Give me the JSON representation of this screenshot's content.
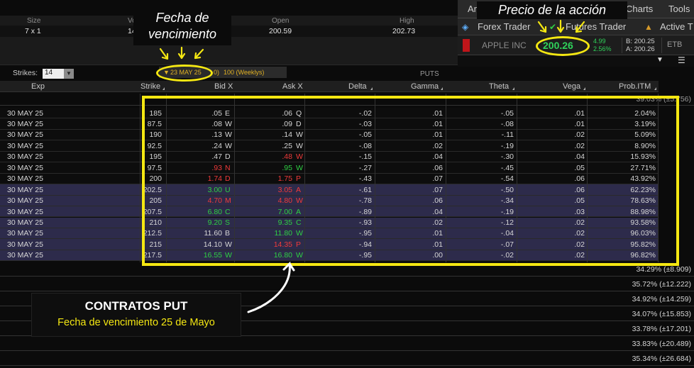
{
  "stats": {
    "headers": [
      "Size",
      "Vo",
      "Open",
      "High"
    ],
    "values": [
      "7 x 1",
      "14",
      "200.59",
      "202.73"
    ]
  },
  "tabs": {
    "row1": [
      "Ana",
      "Charts",
      "Tools"
    ],
    "row2": [
      "Forex Trader",
      "Futures Trader",
      "Active T"
    ]
  },
  "quote": {
    "symbol": "APPLE INC",
    "price": "200.26",
    "change": "4.99",
    "change_pct": "2.56%",
    "bid": "B: 200.25",
    "ask": "A: 200.26",
    "etb": "ETB"
  },
  "controls": {
    "strikes_label": "Strikes:",
    "strikes_value": "14",
    "expiration": "23 MAY 25",
    "exp_days": "0)",
    "exp_note": "100 (Weeklys)",
    "puts_label": "PUTS"
  },
  "columns": [
    "Exp",
    "Strike",
    "Bid X",
    "Ask X",
    "Delta",
    "Gamma",
    "Theta",
    "Vega",
    "Prob.ITM"
  ],
  "iv_first": "39.03% (±5.756)",
  "rows": [
    {
      "exp": "30 MAY 25",
      "strike": "185",
      "bid": ".05",
      "bx": "E",
      "ask": ".06",
      "ax": "Q",
      "delta": "-.02",
      "gamma": ".01",
      "theta": "-.05",
      "vega": ".01",
      "prob": "2.04%",
      "itm": false
    },
    {
      "exp": "30 MAY 25",
      "strike": "87.5",
      "bid": ".08",
      "bx": "W",
      "ask": ".09",
      "ax": "D",
      "delta": "-.03",
      "gamma": ".01",
      "theta": "-.08",
      "vega": ".01",
      "prob": "3.19%",
      "itm": false
    },
    {
      "exp": "30 MAY 25",
      "strike": "190",
      "bid": ".13",
      "bx": "W",
      "ask": ".14",
      "ax": "W",
      "delta": "-.05",
      "gamma": ".01",
      "theta": "-.11",
      "vega": ".02",
      "prob": "5.09%",
      "itm": false
    },
    {
      "exp": "30 MAY 25",
      "strike": "92.5",
      "bid": ".24",
      "bx": "W",
      "ask": ".25",
      "ax": "W",
      "delta": "-.08",
      "gamma": ".02",
      "theta": "-.19",
      "vega": ".02",
      "prob": "8.90%",
      "itm": false
    },
    {
      "exp": "30 MAY 25",
      "strike": "195",
      "bid": ".47",
      "bx": "D",
      "ask": ".48",
      "ax": "W",
      "delta": "-.15",
      "gamma": ".04",
      "theta": "-.30",
      "vega": ".04",
      "prob": "15.93%",
      "itm": false,
      "ask_color": "red"
    },
    {
      "exp": "30 MAY 25",
      "strike": "97.5",
      "bid": ".93",
      "bx": "N",
      "ask": ".95",
      "ax": "W",
      "delta": "-.27",
      "gamma": ".06",
      "theta": "-.45",
      "vega": ".05",
      "prob": "27.71%",
      "itm": false,
      "bid_color": "red",
      "ask_color": "green"
    },
    {
      "exp": "30 MAY 25",
      "strike": "200",
      "bid": "1.74",
      "bx": "D",
      "ask": "1.75",
      "ax": "P",
      "delta": "-.43",
      "gamma": ".07",
      "theta": "-.54",
      "vega": ".06",
      "prob": "43.92%",
      "itm": false,
      "bid_color": "red",
      "ask_color": "red"
    },
    {
      "exp": "30 MAY 25",
      "strike": "202.5",
      "bid": "3.00",
      "bx": "U",
      "ask": "3.05",
      "ax": "A",
      "delta": "-.61",
      "gamma": ".07",
      "theta": "-.50",
      "vega": ".06",
      "prob": "62.23%",
      "itm": true,
      "bid_color": "green",
      "ask_color": "red"
    },
    {
      "exp": "30 MAY 25",
      "strike": "205",
      "bid": "4.70",
      "bx": "M",
      "ask": "4.80",
      "ax": "W",
      "delta": "-.78",
      "gamma": ".06",
      "theta": "-.34",
      "vega": ".05",
      "prob": "78.63%",
      "itm": true,
      "bid_color": "red",
      "ask_color": "red"
    },
    {
      "exp": "30 MAY 25",
      "strike": "207.5",
      "bid": "6.80",
      "bx": "C",
      "ask": "7.00",
      "ax": "A",
      "delta": "-.89",
      "gamma": ".04",
      "theta": "-.19",
      "vega": ".03",
      "prob": "88.98%",
      "itm": true,
      "bid_color": "green",
      "ask_color": "green"
    },
    {
      "exp": "30 MAY 25",
      "strike": "210",
      "bid": "9.20",
      "bx": "S",
      "ask": "9.35",
      "ax": "C",
      "delta": "-.93",
      "gamma": ".02",
      "theta": "-.12",
      "vega": ".02",
      "prob": "93.58%",
      "itm": true,
      "bid_color": "green",
      "ask_color": "green"
    },
    {
      "exp": "30 MAY 25",
      "strike": "212.5",
      "bid": "11.60",
      "bx": "B",
      "ask": "11.80",
      "ax": "W",
      "delta": "-.95",
      "gamma": ".01",
      "theta": "-.04",
      "vega": ".02",
      "prob": "96.03%",
      "itm": true,
      "ask_color": "green"
    },
    {
      "exp": "30 MAY 25",
      "strike": "215",
      "bid": "14.10",
      "bx": "W",
      "ask": "14.35",
      "ax": "P",
      "delta": "-.94",
      "gamma": ".01",
      "theta": "-.07",
      "vega": ".02",
      "prob": "95.82%",
      "itm": true,
      "ask_color": "red"
    },
    {
      "exp": "30 MAY 25",
      "strike": "217.5",
      "bid": "16.55",
      "bx": "W",
      "ask": "16.80",
      "ax": "W",
      "delta": "-.95",
      "gamma": ".00",
      "theta": "-.02",
      "vega": ".02",
      "prob": "96.82%",
      "itm": true,
      "bid_color": "green",
      "ask_color": "green"
    }
  ],
  "iv_rows": [
    "34.29% (±8.909)",
    "35.72% (±12.222)",
    "34.92% (±14.259)",
    "34.07% (±15.853)",
    "33.78% (±17.201)",
    "33.83% (±20.489)",
    "35.34% (±26.684)"
  ],
  "annotations": {
    "fecha_line1": "Fecha de",
    "fecha_line2": "vencimiento",
    "precio": "Precio de la acción",
    "put_title": "CONTRATOS PUT",
    "put_sub": "Fecha de vencimiento 25 de Mayo"
  },
  "colors": {
    "highlight": "#f4e712",
    "itm_bg": "#2d2b4b",
    "green": "#2fcf44",
    "red": "#f03a3a"
  }
}
